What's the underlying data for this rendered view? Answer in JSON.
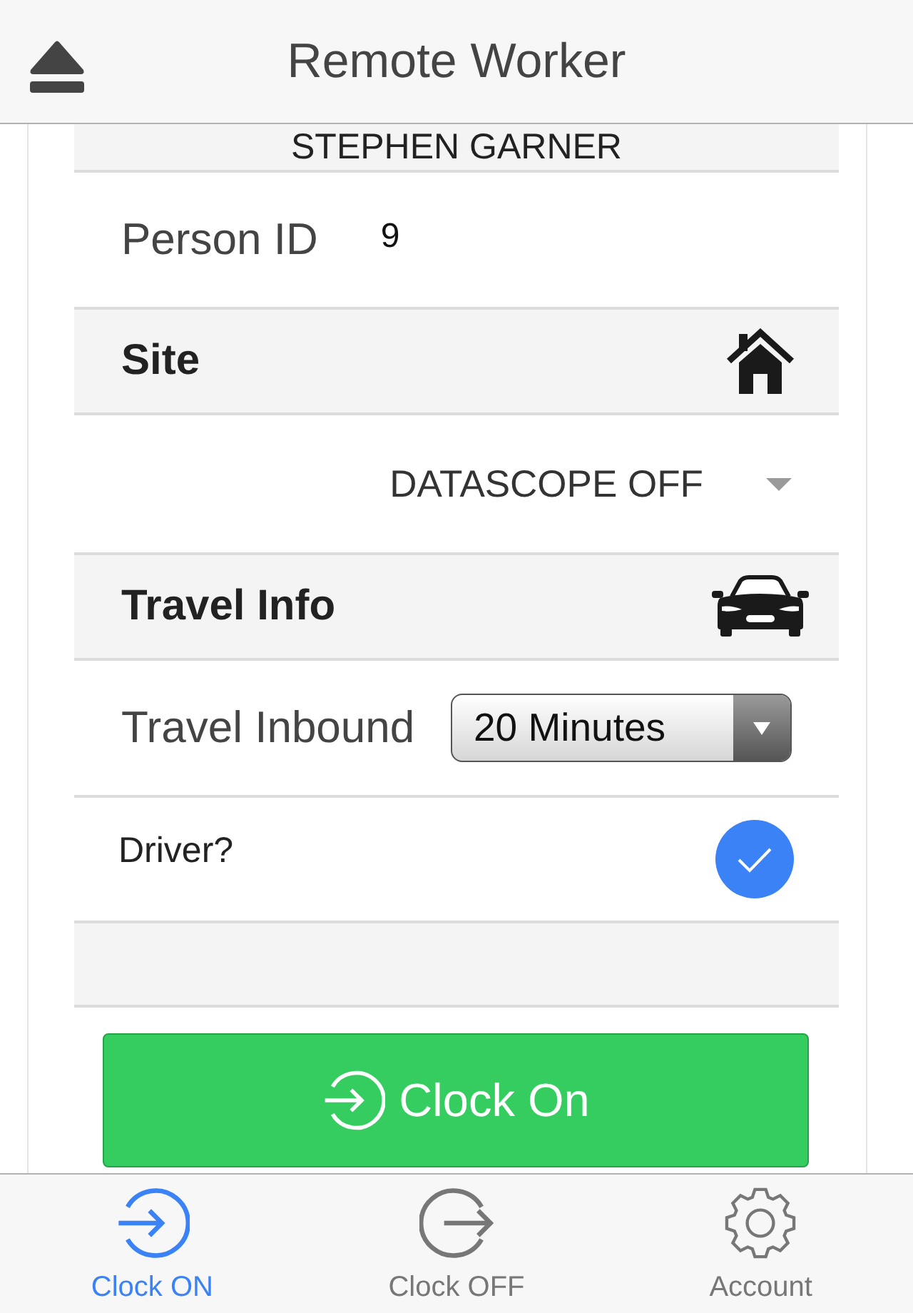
{
  "header": {
    "title": "Remote Worker"
  },
  "profile": {
    "name": "STEPHEN GARNER"
  },
  "form": {
    "items": [
      {
        "kind": "field",
        "label": "Person ID",
        "value": "9"
      },
      {
        "kind": "section",
        "label": "Site"
      },
      {
        "kind": "select",
        "value": "DATASCOPE OFF"
      },
      {
        "kind": "section",
        "label": "Travel Info"
      },
      {
        "kind": "dropdown",
        "label": "Travel Inbound",
        "value": "20 Minutes"
      },
      {
        "kind": "checkbox",
        "label": "Driver?",
        "checked": true
      }
    ]
  },
  "action_button": {
    "label": "Clock On"
  },
  "tabs": [
    {
      "label": "Clock ON",
      "selected": true
    },
    {
      "label": "Clock OFF",
      "selected": false
    },
    {
      "label": "Account",
      "selected": false
    }
  ]
}
